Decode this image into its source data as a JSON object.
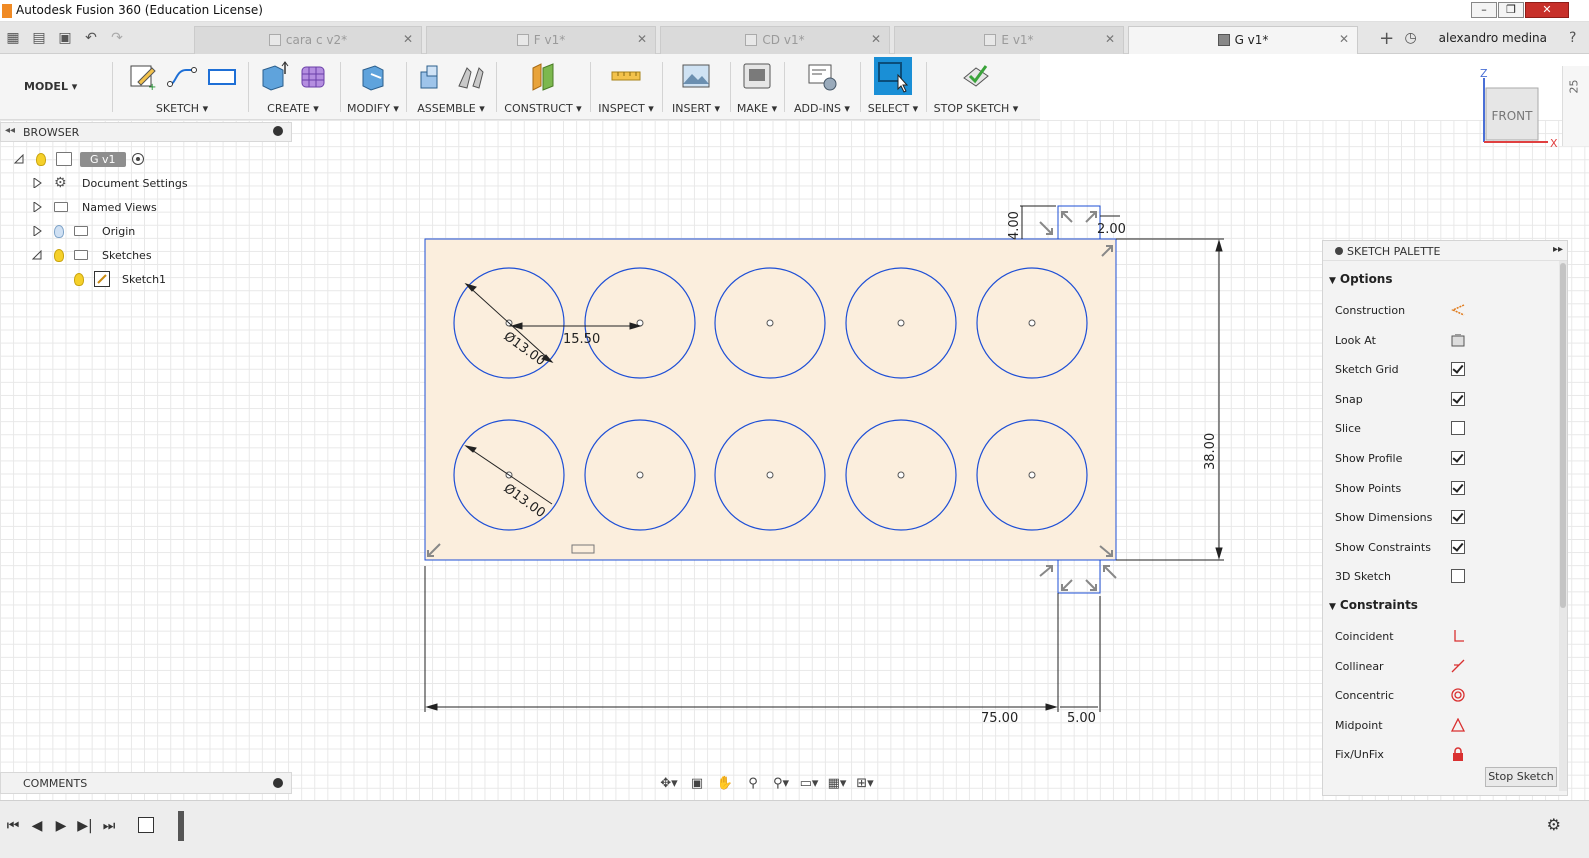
{
  "window": {
    "title": "Autodesk Fusion 360 (Education License)"
  },
  "tabs": [
    {
      "label": "cara c v2*",
      "active": false
    },
    {
      "label": "F v1*",
      "active": false
    },
    {
      "label": "CD v1*",
      "active": false
    },
    {
      "label": "E v1*",
      "active": false
    },
    {
      "label": "G v1*",
      "active": true
    }
  ],
  "user": {
    "name": "alexandro medina"
  },
  "toolbar": {
    "workspace": "MODEL",
    "groups": [
      {
        "label": "SKETCH"
      },
      {
        "label": "CREATE"
      },
      {
        "label": "MODIFY"
      },
      {
        "label": "ASSEMBLE"
      },
      {
        "label": "CONSTRUCT"
      },
      {
        "label": "INSPECT"
      },
      {
        "label": "INSERT"
      },
      {
        "label": "MAKE"
      },
      {
        "label": "ADD-INS"
      },
      {
        "label": "SELECT"
      },
      {
        "label": "STOP SKETCH"
      }
    ]
  },
  "browser": {
    "header": "BROWSER",
    "root": "G v1",
    "items": [
      {
        "label": "Document Settings"
      },
      {
        "label": "Named Views"
      },
      {
        "label": "Origin"
      },
      {
        "label": "Sketches"
      },
      {
        "label": "Sketch1"
      }
    ]
  },
  "comments": {
    "header": "COMMENTS"
  },
  "viewcube": {
    "face": "FRONT",
    "axis_z": "Z",
    "axis_x": "X",
    "ruler": "25"
  },
  "sketch": {
    "dimensions": {
      "height_tab": "4.00",
      "width_tab": "2.00",
      "total_height": "38.00",
      "total_width": "75.00",
      "tab_width": "5.00",
      "spacing": "15.50",
      "diameter_1": "Ø13.00",
      "diameter_2": "Ø13.00"
    }
  },
  "palette": {
    "header": "SKETCH PALETTE",
    "options_header": "Options",
    "options": [
      {
        "label": "Construction",
        "type": "icon"
      },
      {
        "label": "Look At",
        "type": "icon"
      },
      {
        "label": "Sketch Grid",
        "type": "checkbox",
        "checked": true
      },
      {
        "label": "Snap",
        "type": "checkbox",
        "checked": true
      },
      {
        "label": "Slice",
        "type": "checkbox",
        "checked": false
      },
      {
        "label": "Show Profile",
        "type": "checkbox",
        "checked": true
      },
      {
        "label": "Show Points",
        "type": "checkbox",
        "checked": true
      },
      {
        "label": "Show Dimensions",
        "type": "checkbox",
        "checked": true
      },
      {
        "label": "Show Constraints",
        "type": "checkbox",
        "checked": true
      },
      {
        "label": "3D Sketch",
        "type": "checkbox",
        "checked": false
      }
    ],
    "constraints_header": "Constraints",
    "constraints": [
      {
        "label": "Coincident"
      },
      {
        "label": "Collinear"
      },
      {
        "label": "Concentric"
      },
      {
        "label": "Midpoint"
      },
      {
        "label": "Fix/UnFix"
      }
    ],
    "stop_label": "Stop Sketch"
  },
  "colors": {
    "accent": "#1a8fd6",
    "sketch_line": "#1e4fd6",
    "profile_fill": "#fbeedd"
  }
}
